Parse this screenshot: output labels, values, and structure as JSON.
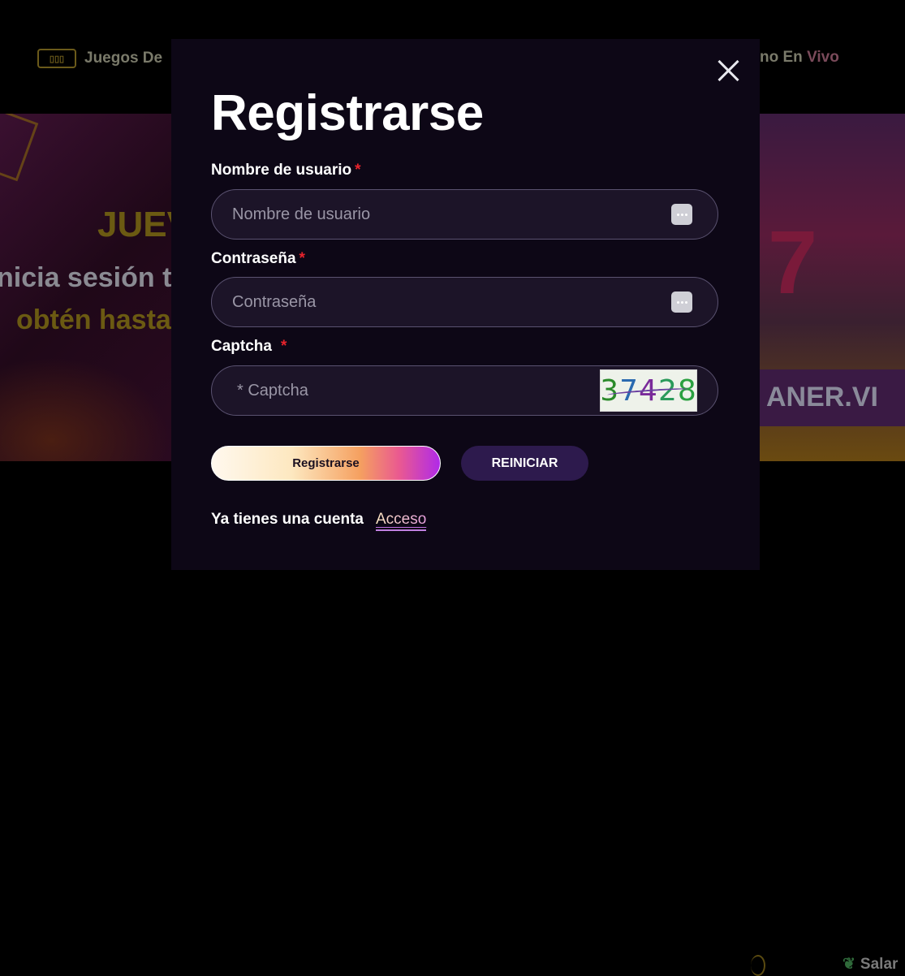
{
  "background": {
    "nav_left_label": "Juegos De",
    "nav_right_label_a": "no En ",
    "nav_right_label_b": "Vivo",
    "banner_left_line1": "JUEV",
    "banner_left_line2": "nicia sesión to",
    "banner_left_line3": "obtén hasta",
    "banner_right_text": "ANER.VI",
    "bottom_right_label": "Salar"
  },
  "modal": {
    "title": "Registrarse",
    "username": {
      "label": "Nombre de usuario",
      "required_mark": "*",
      "placeholder": "Nombre de usuario",
      "value": ""
    },
    "password": {
      "label": "Contraseña",
      "required_mark": "*",
      "placeholder": "Contraseña",
      "value": ""
    },
    "captcha": {
      "label": "Captcha",
      "required_mark": "*",
      "placeholder": "* Captcha",
      "value": "",
      "image_digits": [
        "3",
        "7",
        "4",
        "2",
        "8"
      ]
    },
    "register_button": "Registrarse",
    "reset_button": "REINICIAR",
    "footer_text": "Ya tienes una cuenta",
    "login_link": "Acceso"
  },
  "colors": {
    "modal_bg": "#0d0716",
    "field_bg": "#1c1428",
    "required": "#e8232c",
    "reset_button_bg": "#2d1a4d"
  }
}
